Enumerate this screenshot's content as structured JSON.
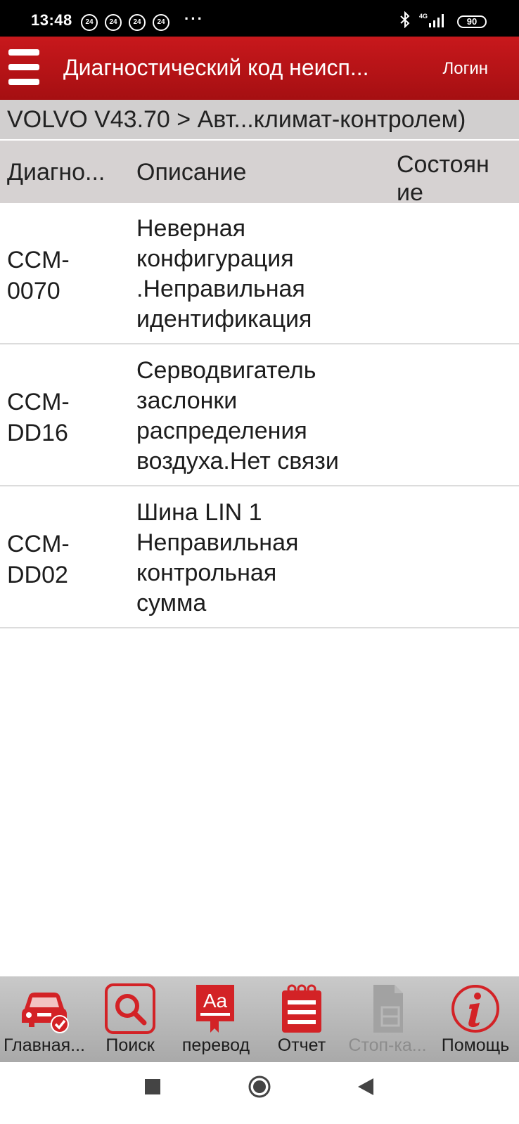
{
  "status_bar": {
    "time": "13:48",
    "badges": [
      "24",
      "24",
      "24",
      "24"
    ],
    "dots": "···",
    "network": "4G",
    "battery": "90"
  },
  "header": {
    "title": "Диагностический код неисп...",
    "login": "Логин"
  },
  "breadcrumb": "VOLVO V43.70 > Авт...климат-контролем)",
  "table": {
    "columns": [
      "Диагно...",
      "Описание",
      "Состоян ие"
    ],
    "rows": [
      {
        "code": [
          "CCM-",
          "0070"
        ],
        "description": [
          "Неверная",
          "конфигурация",
          ".Неправильная",
          "идентификация"
        ]
      },
      {
        "code": [
          "CCM-",
          "DD16"
        ],
        "description": [
          "Серводвигатель",
          "заслонки",
          "распределения",
          "воздуха.Нет связи"
        ]
      },
      {
        "code": [
          "CCM-",
          "DD02"
        ],
        "description": [
          "Шина LIN 1",
          "Неправильная",
          "контрольная",
          "сумма"
        ]
      }
    ]
  },
  "toolbar": {
    "items": [
      {
        "label": "Главная...",
        "icon": "car-check-icon"
      },
      {
        "label": "Поиск",
        "icon": "search-icon"
      },
      {
        "label": "перевод",
        "icon": "translate-icon"
      },
      {
        "label": "Отчет",
        "icon": "report-icon"
      },
      {
        "label": "Стоп-ка...",
        "icon": "freeze-frame-icon",
        "disabled": true
      },
      {
        "label": "Помощь",
        "icon": "info-icon"
      }
    ]
  },
  "colors": {
    "accent": "#c8181c",
    "breadcrumb_bg": "#d1cfcf",
    "toolbar_bg": "#b9b9b9"
  }
}
